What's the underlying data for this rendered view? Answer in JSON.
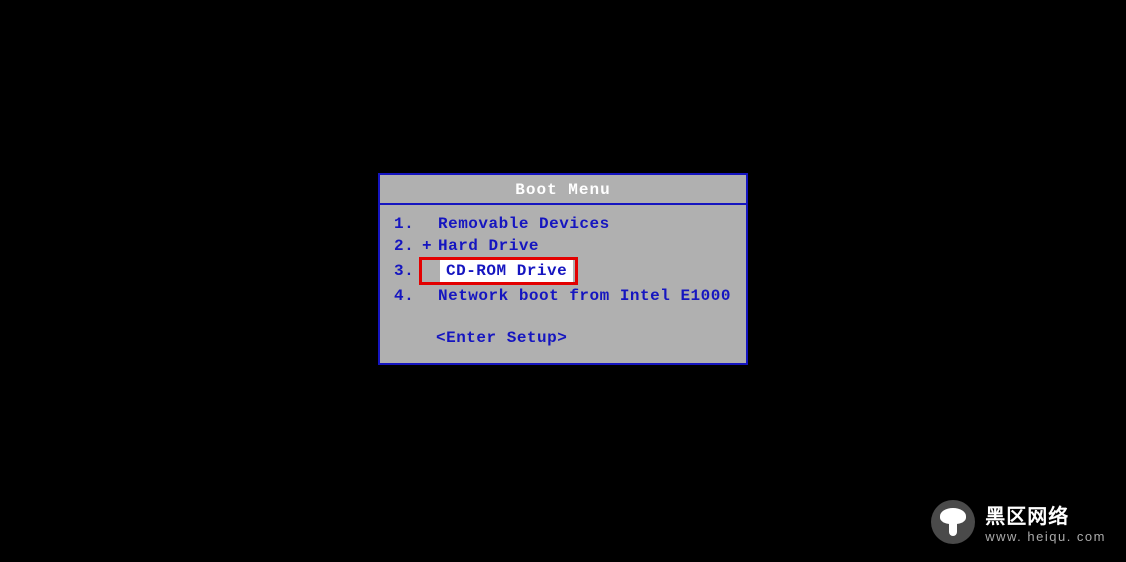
{
  "boot_menu": {
    "title": "Boot Menu",
    "items": [
      {
        "num": "1.",
        "plus": "",
        "label": "Removable Devices",
        "selected": false,
        "highlighted": false
      },
      {
        "num": "2.",
        "plus": "+",
        "label": "Hard Drive",
        "selected": false,
        "highlighted": false
      },
      {
        "num": "3.",
        "plus": "",
        "label": "CD-ROM Drive",
        "selected": true,
        "highlighted": true
      },
      {
        "num": "4.",
        "plus": "",
        "label": "Network boot from Intel E1000",
        "selected": false,
        "highlighted": false
      }
    ],
    "enter_setup": "<Enter Setup>"
  },
  "watermark": {
    "title": "黑区网络",
    "url": "www. heiqu. com"
  }
}
